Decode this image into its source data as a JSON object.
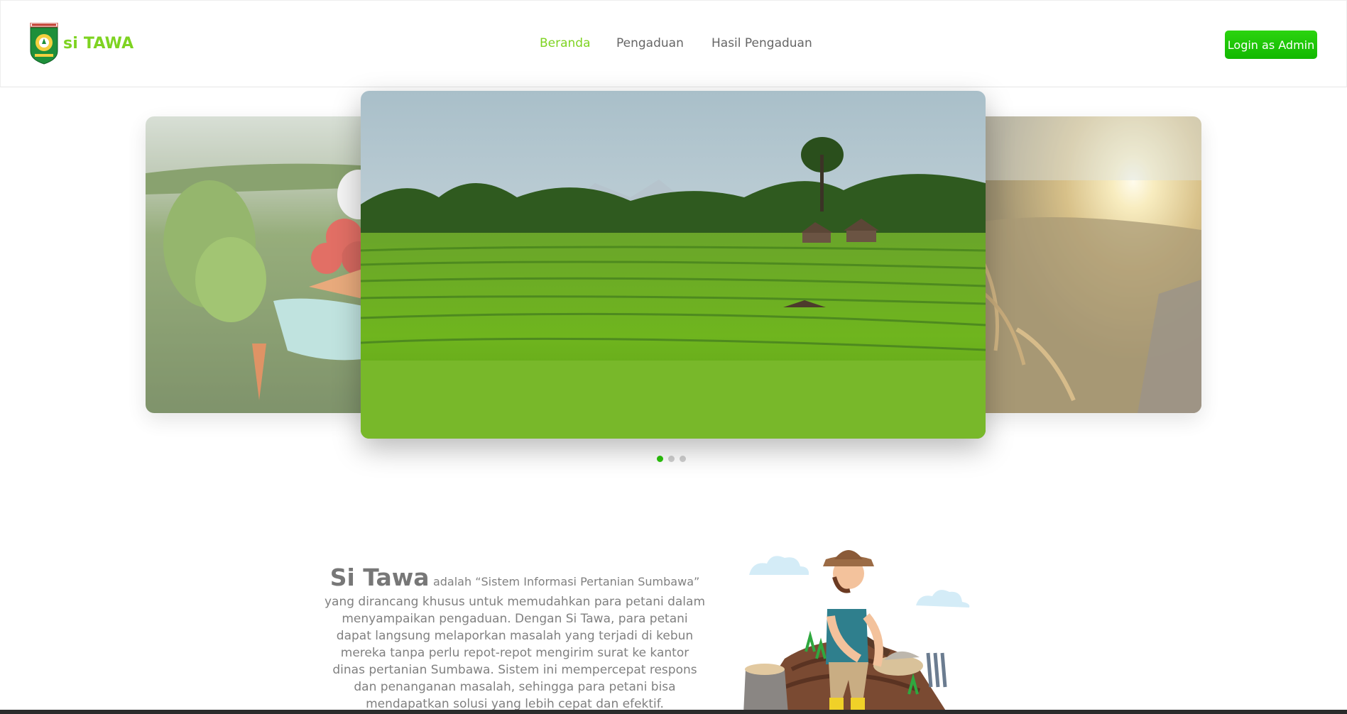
{
  "header": {
    "brand": "si TAWA",
    "nav": [
      {
        "label": "Beranda",
        "active": true
      },
      {
        "label": "Pengaduan",
        "active": false
      },
      {
        "label": "Hasil Pengaduan",
        "active": false
      }
    ],
    "login_label": "Login as Admin"
  },
  "colors": {
    "accent": "#7ed321",
    "button": "#12b800",
    "text": "#808080"
  },
  "carousel": {
    "slides": [
      "vegetables-slide",
      "rice-terraces-slide",
      "grain-sunset-slide"
    ],
    "active_index": 1,
    "dot_count": 3
  },
  "about": {
    "title": "Si Tawa",
    "subtitle": "adalah “Sistem Informasi Pertanian Sumbawa”",
    "body": "yang dirancang khusus untuk memudahkan para petani dalam menyampaikan pengaduan. Dengan Si Tawa, para petani dapat langsung melaporkan masalah yang terjadi di kebun mereka tanpa perlu repot-repot mengirim surat ke kantor dinas pertanian Sumbawa. Sistem ini mempercepat respons dan penanganan masalah, sehingga para petani bisa mendapatkan solusi yang lebih cepat dan efektif."
  }
}
